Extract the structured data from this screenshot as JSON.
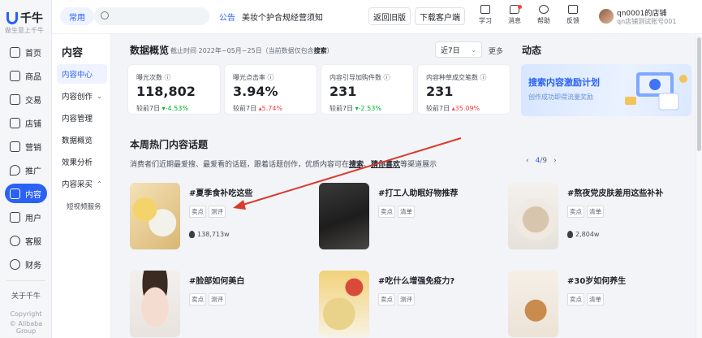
{
  "brand": {
    "name": "千牛",
    "slogan": "做生意上千牛"
  },
  "rail": {
    "items": [
      {
        "label": "首页"
      },
      {
        "label": "商品"
      },
      {
        "label": "交易"
      },
      {
        "label": "店铺"
      },
      {
        "label": "营销"
      },
      {
        "label": "推广"
      },
      {
        "label": "内容"
      },
      {
        "label": "用户"
      },
      {
        "label": "客服"
      },
      {
        "label": "财务"
      }
    ],
    "about": "关于千牛",
    "copyright": "Copyright",
    "company": "© Alibaba Group"
  },
  "topbar": {
    "common": "常用",
    "search_placeholder": "",
    "notice_tag": "公告",
    "notice": "美妆个护合规经营须知",
    "back_old": "返回旧版",
    "download": "下载客户端",
    "tools": [
      {
        "label": "学习"
      },
      {
        "label": "消息"
      },
      {
        "label": "帮助"
      },
      {
        "label": "反馈"
      }
    ],
    "shop_name": "qn0001的店铺",
    "shop_sub": "qn店铺测试账号001"
  },
  "subnav": {
    "title": "内容",
    "items": [
      {
        "label": "内容中心"
      },
      {
        "label": "内容创作"
      },
      {
        "label": "内容管理"
      },
      {
        "label": "数据概览"
      },
      {
        "label": "效果分析"
      },
      {
        "label": "内容采买"
      }
    ],
    "child": "短视频服务"
  },
  "overview": {
    "title": "数据概览",
    "range_prefix": "截止时间 2022年~05月~25日（当前数据仅包含",
    "range_bold": "搜索",
    "range_suffix": "）",
    "select": "近7日",
    "more": "更多",
    "stats": [
      {
        "label": "曝光次数 ⓘ",
        "value": "118,802",
        "cmp_prefix": "较前7日",
        "arrow": "▾",
        "change": "-4.53%",
        "dir": "down"
      },
      {
        "label": "曝光点击率 ⓘ",
        "value": "3.94%",
        "cmp_prefix": "较前7日",
        "arrow": "▴",
        "change": "5.74%",
        "dir": "up"
      },
      {
        "label": "内容引导加购件数 ⓘ",
        "value": "231",
        "cmp_prefix": "较前7日",
        "arrow": "▾",
        "change": "-2.53%",
        "dir": "down"
      },
      {
        "label": "内容种草成交笔数 ⓘ",
        "value": "231",
        "cmp_prefix": "较前7日",
        "arrow": "▴",
        "change": "35.09%",
        "dir": "up"
      }
    ]
  },
  "dynamics": {
    "title": "动态",
    "banner_title": "搜索内容激励计划",
    "banner_sub": "创作成功即得流量奖励"
  },
  "topics": {
    "title": "本周热门内容话题",
    "desc_prefix": "消费者们近期最爱搜、最爱看的话题，跟着话题创作，优质内容可在",
    "desc_link1": "搜索",
    "desc_sep": "、",
    "desc_link2": "猜你喜欢",
    "desc_suffix": "等渠道展示",
    "pager_current": "4",
    "pager_total": "/9",
    "cards": [
      {
        "name": "#夏季食补吃这些",
        "tag1": "卖点",
        "tag2": "测评",
        "heat": "138,713w"
      },
      {
        "name": "#打工人助眠好物推荐",
        "tag1": "卖点",
        "tag2": "清单",
        "heat": ""
      },
      {
        "name": "#熬夜党皮肤差用这些补补",
        "tag1": "卖点",
        "tag2": "清单",
        "heat": "2,804w"
      },
      {
        "name": "#脸部如何美白",
        "tag1": "卖点",
        "tag2": "测评",
        "heat": ""
      },
      {
        "name": "#吃什么增强免疫力?",
        "tag1": "卖点",
        "tag2": "测评",
        "heat": ""
      },
      {
        "name": "#30岁如何养生",
        "tag1": "卖点",
        "tag2": "清单",
        "heat": ""
      }
    ]
  },
  "colors": {
    "accent": "#2a62f5",
    "up": "#f53f3f",
    "down": "#00b42a",
    "annotation_arrow": "#d93a2b"
  }
}
